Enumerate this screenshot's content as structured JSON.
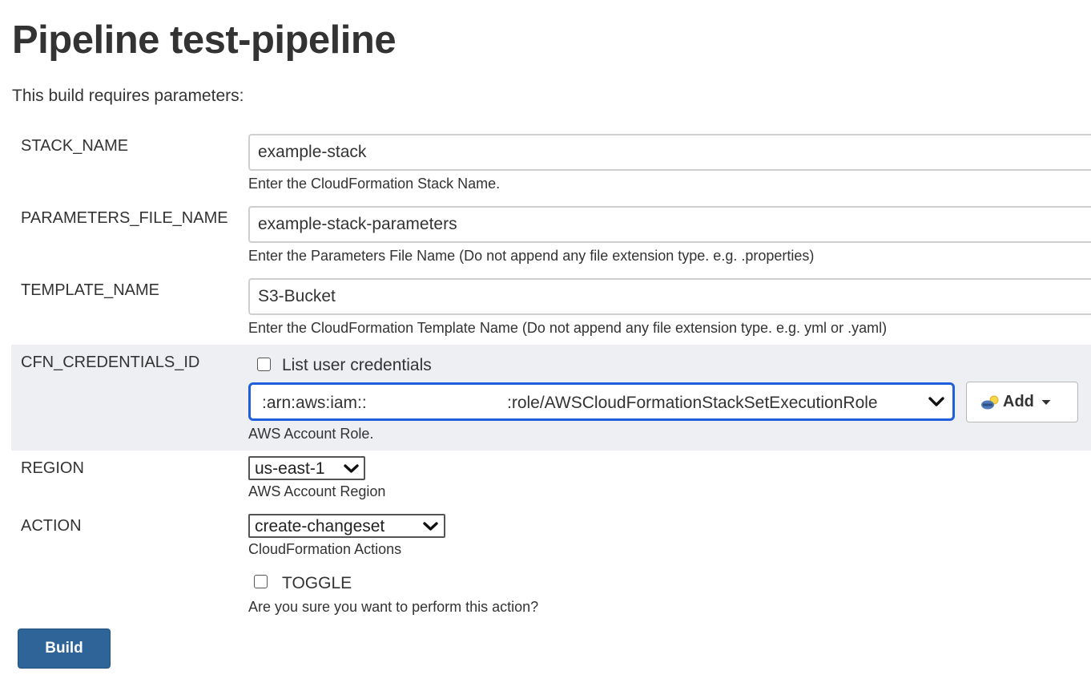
{
  "page": {
    "title": "Pipeline test-pipeline",
    "intro": "This build requires parameters:"
  },
  "params": {
    "stack_name": {
      "label": "STACK_NAME",
      "value": "example-stack",
      "description": "Enter the CloudFormation Stack Name."
    },
    "parameters_file_name": {
      "label": "PARAMETERS_FILE_NAME",
      "value": "example-stack-parameters",
      "description": "Enter the Parameters File Name (Do not append any file extension type. e.g. .properties)"
    },
    "template_name": {
      "label": "TEMPLATE_NAME",
      "value": "S3-Bucket",
      "description": "Enter the CloudFormation Template Name (Do not append any file extension type. e.g. yml or .yaml)"
    },
    "cfn_credentials_id": {
      "label": "CFN_CREDENTIALS_ID",
      "list_user_credentials_label": "List user credentials",
      "list_user_credentials_checked": false,
      "selected_role_prefix": ":arn:aws:iam::",
      "selected_role_suffix": ":role/AWSCloudFormationStackSetExecutionRole",
      "add_button_label": "Add",
      "description": "AWS Account Role."
    },
    "region": {
      "label": "REGION",
      "selected": "us-east-1",
      "description": "AWS Account Region"
    },
    "action": {
      "label": "ACTION",
      "selected": "create-changeset",
      "description": "CloudFormation Actions"
    },
    "toggle": {
      "label": "TOGGLE",
      "checked": false,
      "description": "Are you sure you want to perform this action?"
    }
  },
  "build_button_label": "Build",
  "colors": {
    "primary_button": "#2f6499",
    "focus_border": "#1f5fdb",
    "section_highlight": "#edeff2"
  },
  "icons": {
    "add_button_icon": "credentials-key-icon",
    "dropdown": "chevron-down-icon",
    "add_caret": "caret-down-icon"
  }
}
